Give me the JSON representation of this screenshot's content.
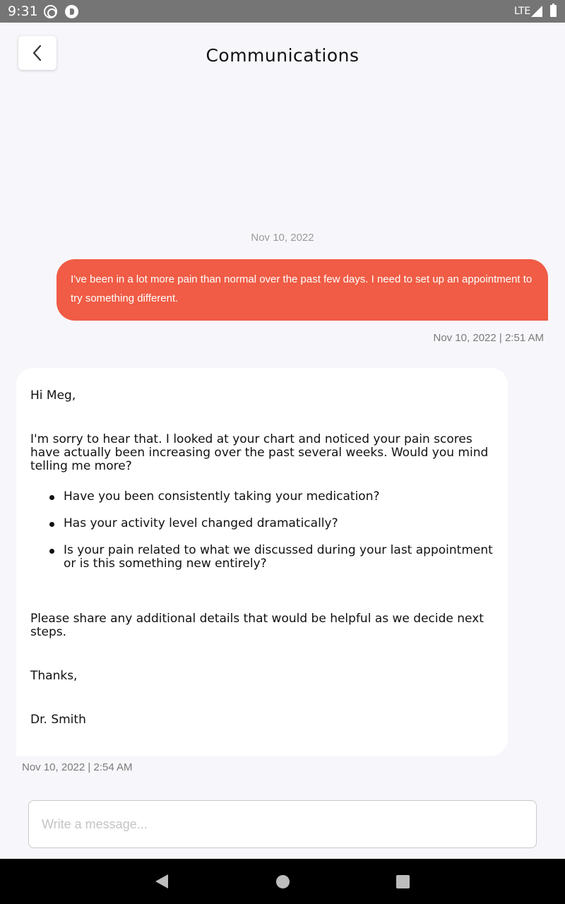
{
  "status_bar": {
    "time": "9:31",
    "network": "LTE",
    "icons": [
      "notification-ring-icon",
      "notification-app-icon",
      "signal-icon",
      "battery-icon"
    ]
  },
  "header": {
    "title": "Communications",
    "back_icon": "chevron-left-icon"
  },
  "conversation": {
    "date_divider": "Nov 10, 2022",
    "outgoing": {
      "text": "I've been in a lot more pain than normal over the past few days. I need to set up an appointment to try something different.",
      "timestamp": "Nov 10, 2022 | 2:51 AM"
    },
    "incoming": {
      "greeting": "Hi Meg,",
      "intro": "I'm sorry to hear that. I looked at your chart and noticed your pain scores have actually been increasing over the past several weeks. Would you mind telling me more?",
      "questions": [
        "Have you been consistently taking your medication?",
        "Has your activity level changed dramatically?",
        "Is your pain related to what we discussed during your last appointment or is this something new entirely?"
      ],
      "closing": "Please share any additional details that would be helpful as we decide next steps.",
      "thanks": "Thanks,",
      "signature": "Dr. Smith",
      "timestamp": "Nov 10, 2022 | 2:54 AM"
    }
  },
  "composer": {
    "placeholder": "Write a message...",
    "value": ""
  },
  "colors": {
    "accent": "#f05c45",
    "background": "#f7f7fb",
    "status_bar": "#757575",
    "nav_bar": "#000000"
  }
}
